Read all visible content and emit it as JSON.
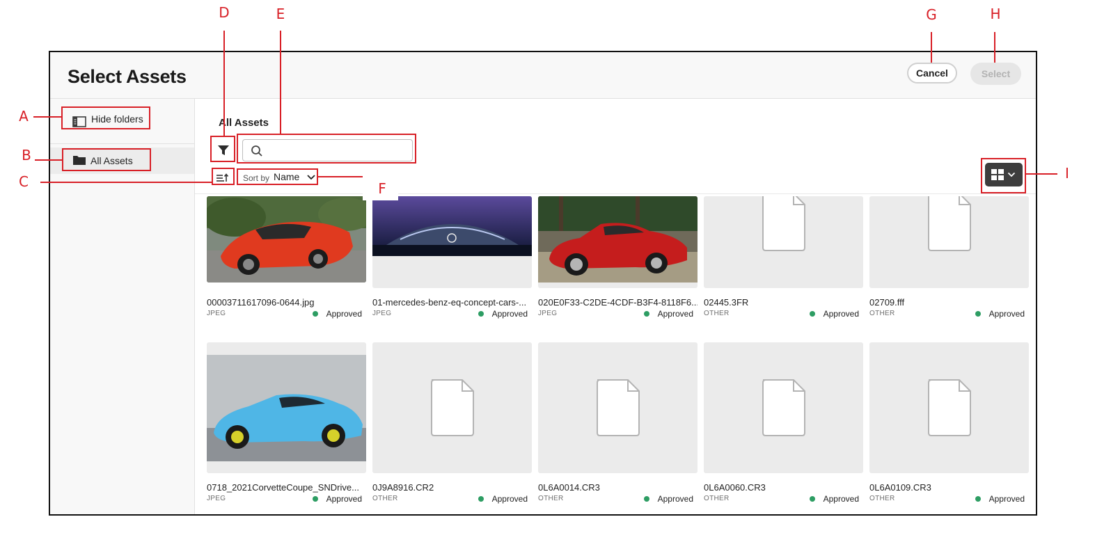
{
  "dialog": {
    "title": "Select Assets",
    "cancel_label": "Cancel",
    "select_label": "Select"
  },
  "sidebar": {
    "hide_folders_label": "Hide folders",
    "items": [
      {
        "label": "All Assets",
        "icon": "folder-icon",
        "selected": true
      }
    ]
  },
  "main": {
    "title": "All Assets",
    "search": {
      "placeholder": ""
    },
    "sort": {
      "label": "Sort by",
      "value": "Name"
    }
  },
  "assets": [
    {
      "name": "00003711617096-0644.jpg",
      "type": "JPEG",
      "status": "Approved",
      "thumb": "red-corvette-photo"
    },
    {
      "name": "01-mercedes-benz-eq-concept-cars-...",
      "type": "JPEG",
      "status": "Approved",
      "thumb": "mercedes-concept-photo"
    },
    {
      "name": "020E0F33-C2DE-4CDF-B3F4-8118F6...",
      "type": "JPEG",
      "status": "Approved",
      "thumb": "red-ferrari-photo"
    },
    {
      "name": "02445.3FR",
      "type": "OTHER",
      "status": "Approved",
      "thumb": "file-icon"
    },
    {
      "name": "02709.fff",
      "type": "OTHER",
      "status": "Approved",
      "thumb": "file-icon"
    },
    {
      "name": "0718_2021CorvetteCoupe_SNDrive...",
      "type": "JPEG",
      "status": "Approved",
      "thumb": "blue-corvette-photo"
    },
    {
      "name": "0J9A8916.CR2",
      "type": "OTHER",
      "status": "Approved",
      "thumb": "file-icon"
    },
    {
      "name": "0L6A0014.CR3",
      "type": "OTHER",
      "status": "Approved",
      "thumb": "file-icon"
    },
    {
      "name": "0L6A0060.CR3",
      "type": "OTHER",
      "status": "Approved",
      "thumb": "file-icon"
    },
    {
      "name": "0L6A0109.CR3",
      "type": "OTHER",
      "status": "Approved",
      "thumb": "file-icon"
    }
  ],
  "callouts": [
    "A",
    "B",
    "C",
    "D",
    "E",
    "F",
    "G",
    "H",
    "I"
  ],
  "colors": {
    "callout": "#d81f26",
    "status_approved": "#2d9d63",
    "view_toggle": "#3d3d3d"
  }
}
